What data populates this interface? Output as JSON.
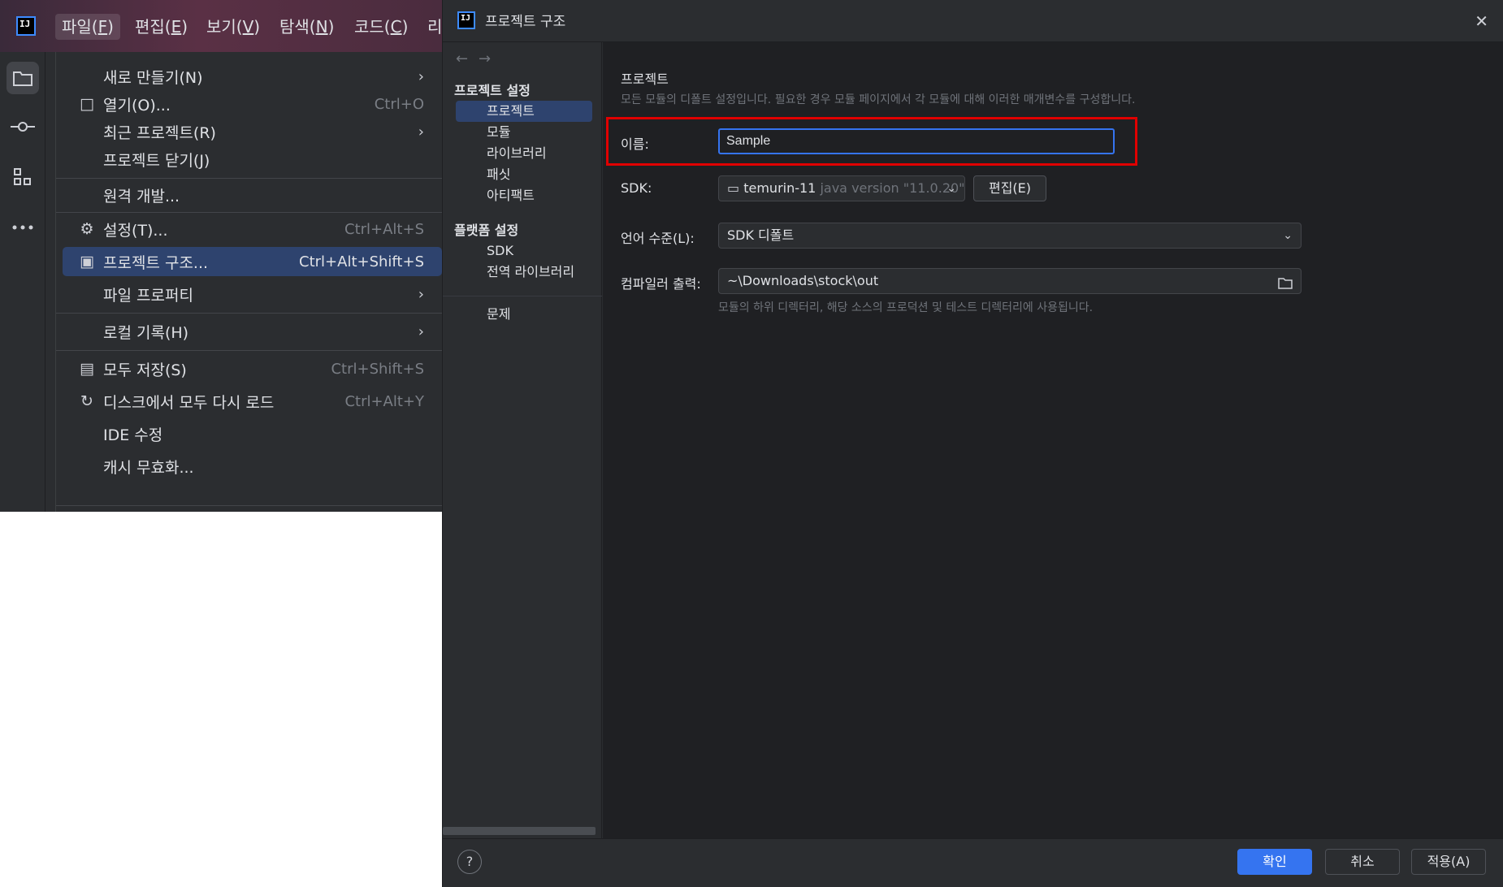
{
  "ide": {
    "logo_text": "IJ",
    "menubar": [
      {
        "label": "파일(",
        "key": "F",
        "after": ")"
      },
      {
        "label": "편집(",
        "key": "E",
        "after": ")"
      },
      {
        "label": "보기(",
        "key": "V",
        "after": ")"
      },
      {
        "label": "탐색(",
        "key": "N",
        "after": ")"
      },
      {
        "label": "코드(",
        "key": "C",
        "after": ")"
      },
      {
        "label": "리",
        "key": "",
        "after": ""
      }
    ],
    "toolstrip_icons": [
      "folder-icon",
      "commit-icon",
      "structure-icon",
      "more-icon"
    ],
    "file_menu": [
      {
        "label": "새로 만들기(N)",
        "shortcut": "",
        "arrow": "›",
        "icon": ""
      },
      {
        "label": "열기(O)...",
        "shortcut": "Ctrl+O",
        "arrow": "",
        "icon": "□"
      },
      {
        "label": "최근 프로젝트(R)",
        "shortcut": "",
        "arrow": "›",
        "icon": ""
      },
      {
        "label": "프로젝트 닫기(J)",
        "shortcut": "",
        "arrow": "",
        "icon": ""
      },
      {
        "label": "원격 개발...",
        "shortcut": "",
        "arrow": "",
        "icon": ""
      },
      {
        "label": "설정(T)...",
        "shortcut": "Ctrl+Alt+S",
        "arrow": "",
        "icon": "⚙"
      },
      {
        "label": "프로젝트 구조...",
        "shortcut": "Ctrl+Alt+Shift+S",
        "arrow": "",
        "icon": "▣"
      },
      {
        "label": "파일 프로퍼티",
        "shortcut": "",
        "arrow": "›",
        "icon": ""
      },
      {
        "label": "로컬 기록(H)",
        "shortcut": "",
        "arrow": "›",
        "icon": ""
      },
      {
        "label": "모두 저장(S)",
        "shortcut": "Ctrl+Shift+S",
        "arrow": "",
        "icon": "▤"
      },
      {
        "label": "디스크에서 모두 다시 로드",
        "shortcut": "Ctrl+Alt+Y",
        "arrow": "",
        "icon": "↻"
      },
      {
        "label": "IDE 수정",
        "shortcut": "",
        "arrow": "",
        "icon": ""
      },
      {
        "label": "캐시 무효화...",
        "shortcut": "",
        "arrow": "",
        "icon": ""
      }
    ]
  },
  "dialog": {
    "logo_text": "IJ",
    "title": "프로젝트 구조",
    "close": "✕",
    "nav": {
      "back": "←",
      "forward": "→",
      "project_settings_header": "프로젝트 설정",
      "project_settings_items": [
        "프로젝트",
        "모듈",
        "라이브러리",
        "패싯",
        "아티팩트"
      ],
      "platform_settings_header": "플랫폼 설정",
      "platform_settings_items": [
        "SDK",
        "전역 라이브러리"
      ],
      "problems": "문제"
    },
    "content": {
      "title": "프로젝트",
      "description": "모든 모듈의 디폴트 설정입니다. 필요한 경우 모듈 페이지에서 각 모듈에 대해 이러한 매개변수를 구성합니다.",
      "name_label": "이름:",
      "name_value": "Sample",
      "sdk_label": "SDK:",
      "sdk_value": "temurin-11",
      "sdk_version": "java version \"11.0.20\"",
      "sdk_edit": "편집(E)",
      "language_label": "언어 수준(L):",
      "language_value": "SDK 디폴트",
      "compiler_label": "컴파일러 출력:",
      "compiler_value": "~\\Downloads\\stock\\out",
      "compiler_hint": "모듈의 하위 디렉터리, 해당 소스의 프로덕션 및 테스트 디렉터리에 사용됩니다."
    },
    "footer": {
      "help": "?",
      "ok": "확인",
      "cancel": "취소",
      "apply": "적용(A)"
    }
  },
  "colors": {
    "highlight_box": "#e00000",
    "accent": "#3574f0",
    "selection": "#2e436e"
  }
}
